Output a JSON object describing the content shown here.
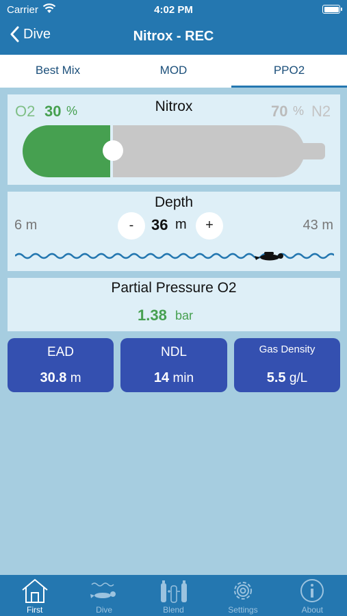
{
  "status": {
    "carrier": "Carrier",
    "time": "4:02 PM"
  },
  "nav": {
    "back_label": "Dive",
    "title": "Nitrox - REC"
  },
  "tabs": [
    {
      "label": "Best Mix",
      "active": false
    },
    {
      "label": "MOD",
      "active": false
    },
    {
      "label": "PPO2",
      "active": true
    }
  ],
  "nitrox": {
    "title": "Nitrox",
    "o2_label": "O2",
    "o2_value": "30",
    "o2_unit": "%",
    "n2_value": "70",
    "n2_unit": "%",
    "n2_label": "N2",
    "o2_fraction": 0.3
  },
  "depth": {
    "title": "Depth",
    "min_label": "6 m",
    "max_label": "43 m",
    "minus_label": "-",
    "plus_label": "+",
    "value": "36",
    "unit": "m"
  },
  "ppo2": {
    "title": "Partial Pressure O2",
    "value": "1.38",
    "unit": "bar"
  },
  "stats": [
    {
      "label": "EAD",
      "value": "30.8",
      "unit": "m"
    },
    {
      "label": "NDL",
      "value": "14",
      "unit": "min"
    },
    {
      "label": "Gas Density",
      "value": "5.5",
      "unit": "g/L"
    }
  ],
  "tabbar": [
    {
      "label": "First",
      "icon": "house-icon"
    },
    {
      "label": "Dive",
      "icon": "diver-icon"
    },
    {
      "label": "Blend",
      "icon": "tanks-icon"
    },
    {
      "label": "Settings",
      "icon": "gear-icon"
    },
    {
      "label": "About",
      "icon": "info-icon"
    }
  ],
  "colors": {
    "primary": "#2477b0",
    "o2_green": "#46a050",
    "n2_gray": "#c7c7c7",
    "stat_blue": "#3450b0",
    "background": "#a6cde0"
  }
}
